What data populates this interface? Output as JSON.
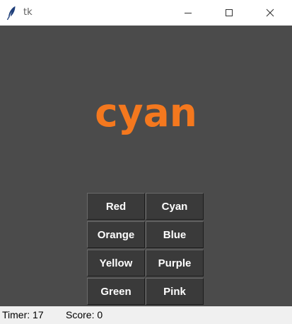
{
  "window": {
    "title": "tk",
    "controls": {
      "minimize_icon": "minimize-icon",
      "maximize_icon": "maximize-icon",
      "close_icon": "close-icon"
    }
  },
  "game": {
    "word": "cyan",
    "word_color": "#f4781e",
    "background": "#4b4b4b",
    "buttons": [
      {
        "label": "Red"
      },
      {
        "label": "Cyan"
      },
      {
        "label": "Orange"
      },
      {
        "label": "Blue"
      },
      {
        "label": "Yellow"
      },
      {
        "label": "Purple"
      },
      {
        "label": "Green"
      },
      {
        "label": "Pink"
      }
    ]
  },
  "status": {
    "timer": "Timer: 17",
    "score": "Score: 0"
  }
}
